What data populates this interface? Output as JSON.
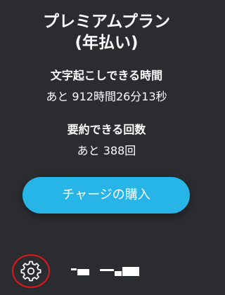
{
  "plan": {
    "title_line1": "プレミアムプラン",
    "title_line2": "(年払い)"
  },
  "transcription": {
    "label": "文字起こしできる時間",
    "remaining": "あと 912時間26分13秒"
  },
  "summary": {
    "label": "要約できる回数",
    "remaining": "あと 388回"
  },
  "charge_button": {
    "label": "チャージの購入",
    "color": "#27b4e7"
  },
  "footer": {
    "settings_icon": "gear-icon",
    "highlight_color": "#e2161c"
  }
}
